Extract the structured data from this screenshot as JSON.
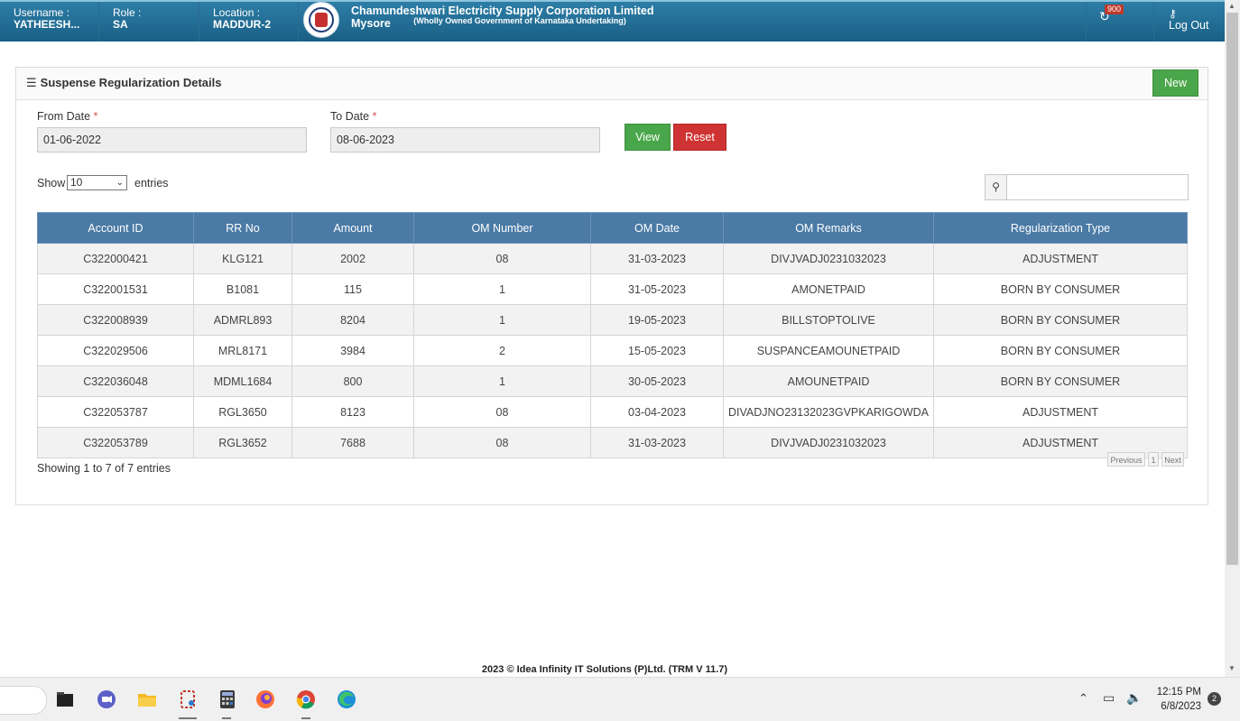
{
  "header": {
    "username_label": "Username :",
    "username": "YATHEESH...",
    "role_label": "Role :",
    "role": "SA",
    "location_label": "Location :",
    "location": "MADDUR-2",
    "org_title": "Chamundeshwari Electricity Supply Corporation Limited Mysore",
    "org_subtitle": "(Wholly Owned Government of Karnataka Undertaking)",
    "notification_count": "900",
    "logout_label": "Log Out"
  },
  "panel": {
    "title": "Suspense Regularization Details",
    "new_button": "New"
  },
  "filters": {
    "from_label": "From Date",
    "from_value": "01-06-2022",
    "to_label": "To Date",
    "to_value": "08-06-2023",
    "required_mark": "*",
    "view_button": "View",
    "reset_button": "Reset"
  },
  "table_controls": {
    "show_label": "Show",
    "page_size": "10",
    "entries_label": "entries",
    "search_value": ""
  },
  "table": {
    "columns": [
      "Account ID",
      "RR No",
      "Amount",
      "OM Number",
      "OM Date",
      "OM Remarks",
      "Regularization Type"
    ],
    "rows": [
      [
        "C322000421",
        "KLG121",
        "2002",
        "08",
        "31-03-2023",
        "DIVJVADJ0231032023",
        "ADJUSTMENT"
      ],
      [
        "C322001531",
        "B1081",
        "115",
        "1",
        "31-05-2023",
        "AMONETPAID",
        "BORN BY CONSUMER"
      ],
      [
        "C322008939",
        "ADMRL893",
        "8204",
        "1",
        "19-05-2023",
        "BILLSTOPTOLIVE",
        "BORN BY CONSUMER"
      ],
      [
        "C322029506",
        "MRL8171",
        "3984",
        "2",
        "15-05-2023",
        "SUSPANCEAMOUNETPAID",
        "BORN BY CONSUMER"
      ],
      [
        "C322036048",
        "MDML1684",
        "800",
        "1",
        "30-05-2023",
        "AMOUNETPAID",
        "BORN BY CONSUMER"
      ],
      [
        "C322053787",
        "RGL3650",
        "8123",
        "08",
        "03-04-2023",
        "DIVADJNO23132023GVPKARIGOWDA",
        "ADJUSTMENT"
      ],
      [
        "C322053789",
        "RGL3652",
        "7688",
        "08",
        "31-03-2023",
        "DIVJVADJ0231032023",
        "ADJUSTMENT"
      ]
    ]
  },
  "pagination": {
    "summary": "Showing 1 to 7 of 7 entries",
    "previous": "Previous",
    "current_page": "1",
    "next": "Next"
  },
  "footer": {
    "text": "2023 © Idea Infinity IT Solutions (P)Ltd. (TRM V 11.7)"
  },
  "taskbar": {
    "apps": [
      "file-explorer-icon",
      "zoom-icon",
      "folder-icon",
      "snipping-tool-icon",
      "calculator-icon",
      "firefox-icon",
      "chrome-icon",
      "edge-icon"
    ],
    "time": "12:15 PM",
    "date": "6/8/2023",
    "notification_count": "2"
  },
  "colors": {
    "header_bg": "#1a5f85",
    "table_header_bg": "#4a7aa5",
    "success": "#4aa64a",
    "danger": "#cf3333"
  }
}
